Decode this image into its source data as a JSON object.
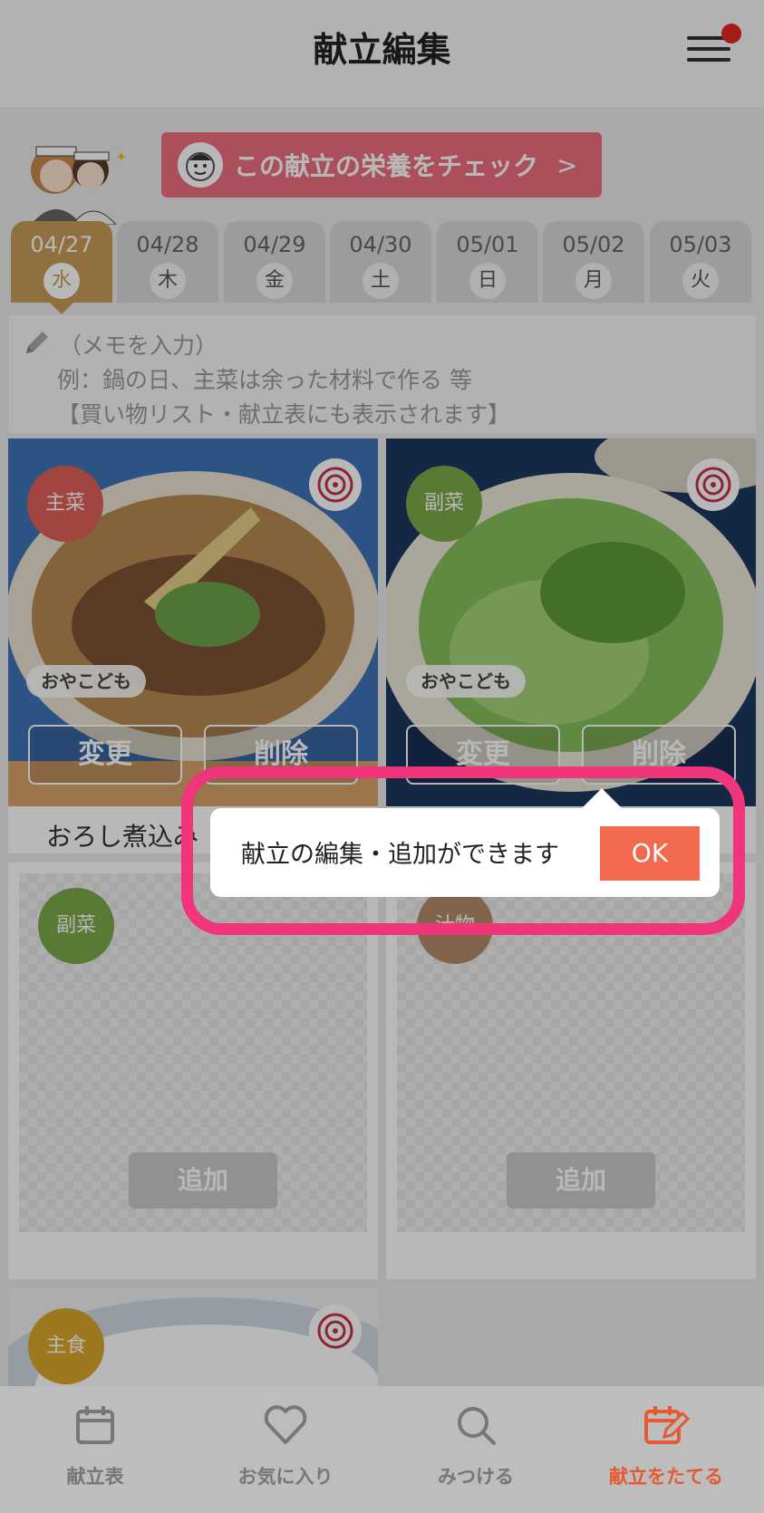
{
  "header": {
    "title": "献立編集",
    "menu_icon": "hamburger-menu-icon",
    "notification_color": "#e4281e"
  },
  "nutrition_button": {
    "label": "この献立の栄養をチェック",
    "chevron": ">",
    "color": "#ee6f7e"
  },
  "day_tabs": [
    {
      "date": "04/27",
      "dow": "水",
      "active": true
    },
    {
      "date": "04/28",
      "dow": "木",
      "active": false
    },
    {
      "date": "04/29",
      "dow": "金",
      "active": false
    },
    {
      "date": "04/30",
      "dow": "土",
      "active": false
    },
    {
      "date": "05/01",
      "dow": "日",
      "active": false
    },
    {
      "date": "05/02",
      "dow": "月",
      "active": false
    },
    {
      "date": "05/03",
      "dow": "火",
      "active": false
    }
  ],
  "memo": {
    "placeholder": "（メモを入力）",
    "example": "例：鍋の日、主菜は余った材料で作る 等",
    "note": "【買い物リスト・献立表にも表示されます】"
  },
  "dishes": [
    {
      "category": "主菜",
      "tag": "おやこども",
      "change_label": "変更",
      "delete_label": "削除",
      "name": "おろし煮込み"
    },
    {
      "category": "副菜",
      "tag": "おやこども",
      "change_label": "変更",
      "delete_label": "削除",
      "name": ""
    }
  ],
  "empty_slots": [
    {
      "category": "副菜",
      "add_label": "追加"
    },
    {
      "category": "汁物",
      "add_label": "追加"
    }
  ],
  "staple": {
    "category": "主食"
  },
  "tooltip": {
    "message": "献立の編集・追加ができます",
    "ok_label": "OK",
    "ring_color": "#f0357b"
  },
  "bottom_nav": [
    {
      "label": "献立表",
      "icon": "calendar-icon",
      "active": false
    },
    {
      "label": "お気に入り",
      "icon": "heart-icon",
      "active": false
    },
    {
      "label": "みつける",
      "icon": "search-icon",
      "active": false
    },
    {
      "label": "献立をたてる",
      "icon": "edit-calendar-icon",
      "active": true
    }
  ],
  "colors": {
    "accent": "#c89b58",
    "main_dish": "#e0605a",
    "side_dish": "#7aa94a",
    "soup": "#b48a6a",
    "staple": "#d9a72c",
    "active_nav": "#e65a33"
  }
}
